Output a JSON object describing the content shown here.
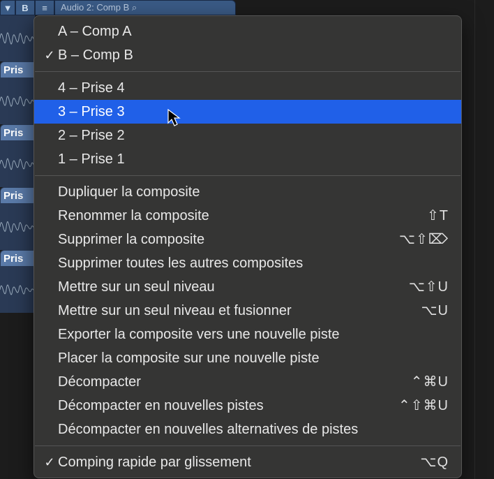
{
  "top": {
    "disclosure": "▼",
    "letter": "B",
    "menu_icon": "≡",
    "title": "Audio 2: Comp B ⁠⌕"
  },
  "tracks": [
    {
      "label": "Pris"
    },
    {
      "label": "Pris"
    },
    {
      "label": "Pris"
    },
    {
      "label": "Pris"
    }
  ],
  "menu": {
    "comps": [
      {
        "checked": false,
        "label": "A – Comp A"
      },
      {
        "checked": true,
        "label": "B – Comp B"
      }
    ],
    "takes": [
      {
        "label": "4 – Prise 4",
        "highlight": false
      },
      {
        "label": "3 – Prise 3",
        "highlight": true
      },
      {
        "label": "2 – Prise 2",
        "highlight": false
      },
      {
        "label": "1 – Prise 1",
        "highlight": false
      }
    ],
    "actions": [
      {
        "label": "Dupliquer la composite",
        "shortcut": ""
      },
      {
        "label": "Renommer la composite",
        "shortcut": "⇧T"
      },
      {
        "label": "Supprimer la composite",
        "shortcut": "⌥⇧⌦"
      },
      {
        "label": "Supprimer toutes les autres composites",
        "shortcut": ""
      },
      {
        "label": "Mettre sur un seul niveau",
        "shortcut": "⌥⇧U"
      },
      {
        "label": "Mettre sur un seul niveau et fusionner",
        "shortcut": "⌥U"
      },
      {
        "label": "Exporter la composite vers une nouvelle piste",
        "shortcut": ""
      },
      {
        "label": "Placer la composite sur une nouvelle piste",
        "shortcut": ""
      },
      {
        "label": "Décompacter",
        "shortcut": "⌃⌘U"
      },
      {
        "label": "Décompacter en nouvelles pistes",
        "shortcut": "⌃⇧⌘U"
      },
      {
        "label": "Décompacter en nouvelles alternatives de pistes",
        "shortcut": ""
      }
    ],
    "footer": [
      {
        "checked": true,
        "label": "Comping rapide par glissement",
        "shortcut": "⌥Q"
      }
    ]
  }
}
